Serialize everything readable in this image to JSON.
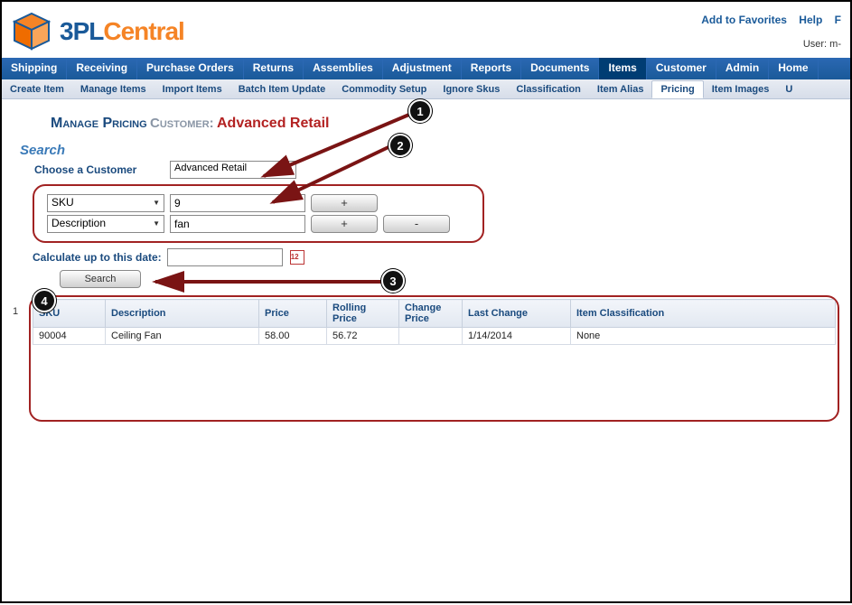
{
  "header": {
    "brand_part1": "3PL",
    "brand_part2": "Central",
    "links": {
      "favorites": "Add to Favorites",
      "help": "Help",
      "more": "F"
    },
    "user_prefix": "User:",
    "user_value": "m-"
  },
  "nav_primary": [
    "Shipping",
    "Receiving",
    "Purchase Orders",
    "Returns",
    "Assemblies",
    "Adjustment",
    "Reports",
    "Documents",
    "Items",
    "Customer",
    "Admin",
    "Home"
  ],
  "nav_primary_active": "Items",
  "nav_secondary": [
    "Create Item",
    "Manage Items",
    "Import Items",
    "Batch Item Update",
    "Commodity Setup",
    "Ignore Skus",
    "Classification",
    "Item Alias",
    "Pricing",
    "Item Images",
    "U"
  ],
  "nav_secondary_active": "Pricing",
  "page": {
    "title": "Manage Pricing",
    "sub_label": "Customer:",
    "customer": "Advanced Retail"
  },
  "search": {
    "heading": "Search",
    "choose_customer_label": "Choose a Customer",
    "customer_value": "Advanced Retail",
    "filters": [
      {
        "field": "SKU",
        "value": "9"
      },
      {
        "field": "Description",
        "value": "fan"
      }
    ],
    "plus_label": "+",
    "minus_label": "-",
    "calc_label": "Calculate up to this date:",
    "calc_value": "",
    "search_button": "Search"
  },
  "grid": {
    "page_indicator": "1",
    "columns": [
      "SKU",
      "Description",
      "Price",
      "Rolling Price",
      "Change Price",
      "Last Change",
      "Item Classification"
    ],
    "rows": [
      {
        "sku": "90004",
        "description": "Ceiling Fan",
        "price": "58.00",
        "rolling_price": "56.72",
        "change_price": "",
        "last_change": "1/14/2014",
        "classification": "None"
      }
    ]
  },
  "annotations": {
    "b1": "1",
    "b2": "2",
    "b3": "3",
    "b4": "4"
  }
}
